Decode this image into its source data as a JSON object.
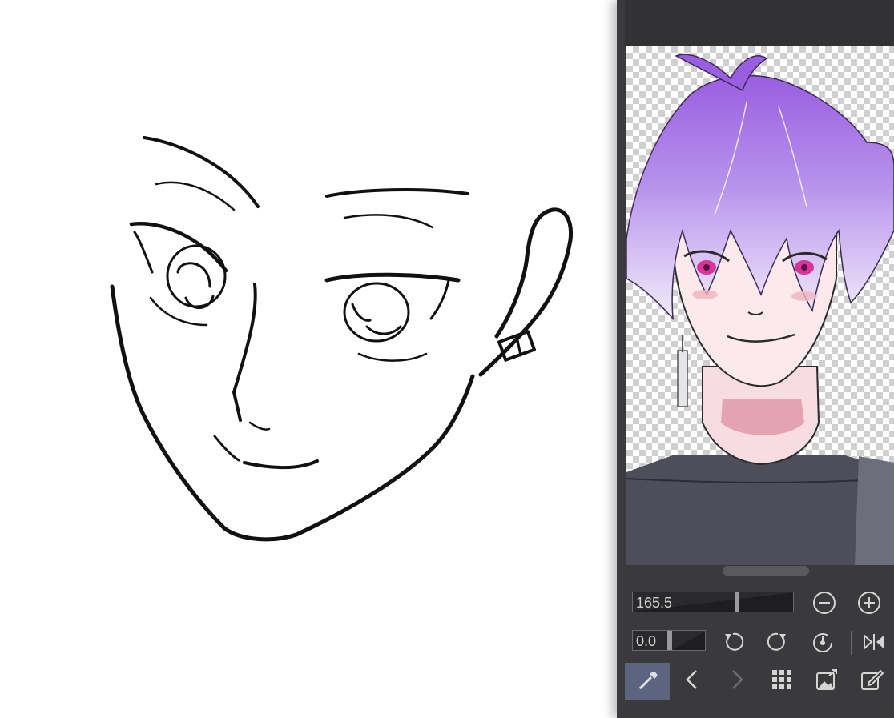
{
  "app": {
    "panel": "navigator",
    "theme_colors": {
      "panel_bg": "#3a3a3c",
      "panel_topbar": "#323234",
      "active_tool": "#5c6580",
      "icon": "#d4d4d4",
      "icon_disabled": "#6c6c70"
    }
  },
  "navigator": {
    "zoom_value": "165.5",
    "zoom_level_percent": 165.5,
    "rotation_value": "0.0",
    "rotation_level": 0.0,
    "buttons": {
      "zoom_out": "minus-circle-icon",
      "zoom_in": "plus-circle-icon",
      "rotate_left": "rotate-ccw-icon",
      "rotate_right": "rotate-cw-icon",
      "reset_rotation": "reset-dial-icon",
      "flip_horizontal": "flip-horizontal-icon"
    }
  },
  "bottom_bar": {
    "tools": [
      {
        "name": "eyedropper-icon",
        "active": true
      },
      {
        "name": "chevron-left-icon",
        "active": false
      },
      {
        "name": "chevron-right-icon",
        "active": false,
        "disabled": true
      },
      {
        "name": "grid-icon",
        "active": false
      },
      {
        "name": "export-image-icon",
        "active": false
      },
      {
        "name": "edit-icon",
        "active": false
      }
    ]
  }
}
